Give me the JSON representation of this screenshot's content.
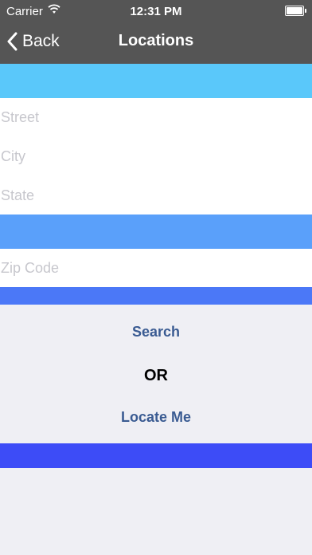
{
  "status_bar": {
    "carrier": "Carrier",
    "time": "12:31 PM",
    "icons": [
      "wifi-icon",
      "battery-icon"
    ]
  },
  "nav": {
    "back_label": "Back",
    "title": "Locations"
  },
  "form": {
    "street_placeholder": "Street",
    "city_placeholder": "City",
    "state_placeholder": "State",
    "zip_placeholder": "Zip Code"
  },
  "actions": {
    "search_label": "Search",
    "or_label": "OR",
    "locate_label": "Locate Me"
  },
  "colors": {
    "nav_bg": "#555555",
    "band_1": "#5ac8fa",
    "band_2": "#5aa0fa",
    "band_3": "#4b78f7",
    "band_4": "#3d4cf7",
    "background": "#efeff4",
    "action_text": "#3a5b92"
  }
}
